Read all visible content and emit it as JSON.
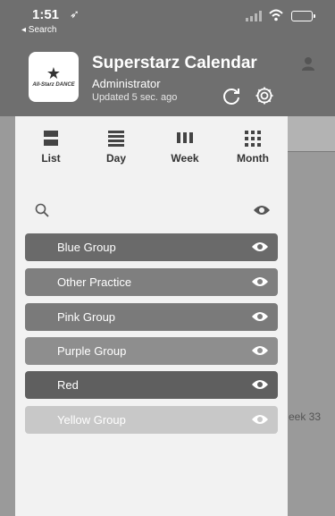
{
  "status_bar": {
    "time": "1:51",
    "location_arrow": "➶",
    "back_label": "◂ Search"
  },
  "drawer": {
    "calendar_title": "Superstarz Calendar",
    "logo_text": "All-Starz DANCE",
    "user_role": "Administrator",
    "updated": "Updated 5 sec. ago"
  },
  "views": [
    {
      "label": "List",
      "icon": "list-icon"
    },
    {
      "label": "Day",
      "icon": "day-icon"
    },
    {
      "label": "Week",
      "icon": "week-icon"
    },
    {
      "label": "Month",
      "icon": "month-icon"
    }
  ],
  "groups": [
    {
      "label": "Blue Group",
      "color": "#6a6a6a"
    },
    {
      "label": "Other Practice",
      "color": "#7f7f7f"
    },
    {
      "label": "Pink Group",
      "color": "#7a7a7a"
    },
    {
      "label": "Purple Group",
      "color": "#8e8e8e"
    },
    {
      "label": "Red",
      "color": "#5f5f5f"
    },
    {
      "label": "Yellow Group",
      "color": "#c8c8c8"
    }
  ],
  "background": {
    "week_text": "eek 33"
  }
}
